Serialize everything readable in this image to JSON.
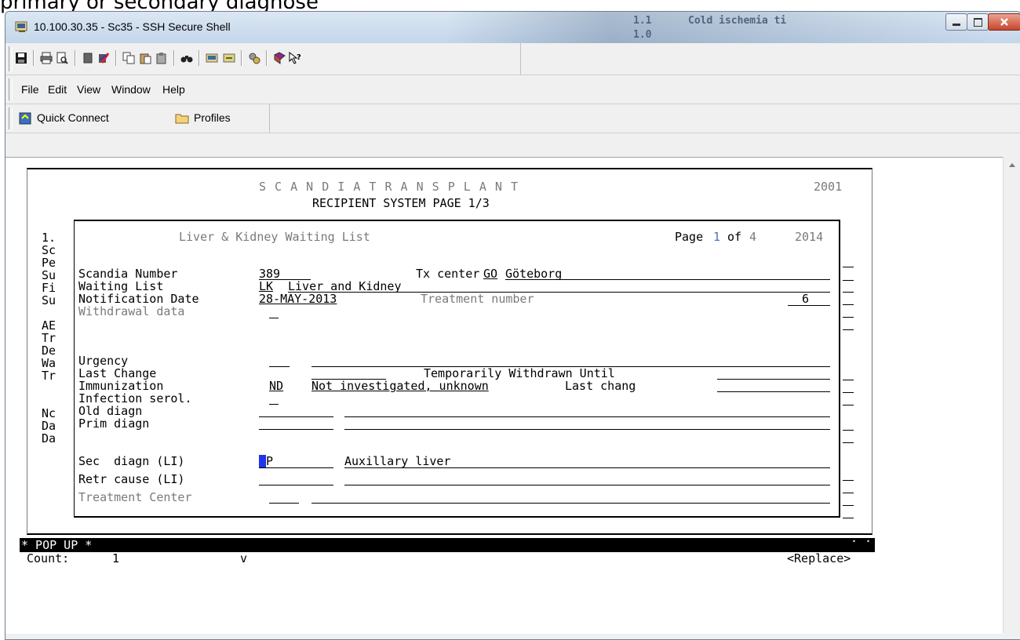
{
  "background_text": "primary or secondary diagnose",
  "window": {
    "title": "10.100.30.35 - Sc35 - SSH Secure Shell",
    "bg_ghost": [
      "1.1",
      "Cold ischemia ti",
      "1.0"
    ]
  },
  "menu": [
    "File",
    "Edit",
    "View",
    "Window",
    "Help"
  ],
  "profile_bar": {
    "quick_connect": "Quick Connect",
    "profiles": "Profiles"
  },
  "terminal": {
    "header_title": "S C A N D I A T R A N S P L A N T",
    "header_year": "2001",
    "header_subtitle": "RECIPIENT SYSTEM PAGE 1/3",
    "left_stubs": [
      "1.",
      "Sc",
      "Pe",
      "Su",
      "Fi",
      "Su",
      "",
      "AE",
      "Tr",
      "De",
      "Wa",
      "Tr",
      "",
      "",
      "Nc",
      "Da",
      "Da"
    ],
    "popup": {
      "title": "Liver & Kidney Waiting List",
      "page_label": "Page",
      "page_num": "1",
      "page_of": "of",
      "page_total": "4",
      "year": "2014",
      "fields": {
        "scandia_label": "Scandia Number",
        "scandia_value": "389",
        "tx_center_label": "Tx center",
        "tx_center_code": "GO",
        "tx_center_name": "Göteborg",
        "waiting_list_label": "Waiting List",
        "waiting_list_code": "LK",
        "waiting_list_name": "Liver and Kidney",
        "notif_label": "Notification Date",
        "notif_value": "28-MAY-2013",
        "treatment_num_label": "Treatment number",
        "treatment_num_value": "6",
        "withdrawal_label": "Withdrawal data",
        "urgency_label": "Urgency",
        "last_change_label": "Last Change",
        "temp_withdrawn_label": "Temporarily Withdrawn Until",
        "immunization_label": "Immunization",
        "immunization_code": "ND",
        "immunization_text": "Not investigated, unknown",
        "last_chang_label": "Last chang",
        "infection_label": "Infection serol.",
        "old_diagn_label": "Old diagn",
        "prim_diagn_label": "Prim diagn",
        "sec_diagn_label": "Sec  diagn (LI)",
        "sec_diagn_code": "P",
        "sec_diagn_text": "Auxillary liver",
        "retr_cause_label": "Retr cause (LI)",
        "treatment_center_label": "Treatment Center"
      }
    },
    "status_bar": "* POP UP *",
    "count_label": "Count:",
    "count_value": "1",
    "count_mark": "v",
    "replace_label": "<Replace>"
  }
}
